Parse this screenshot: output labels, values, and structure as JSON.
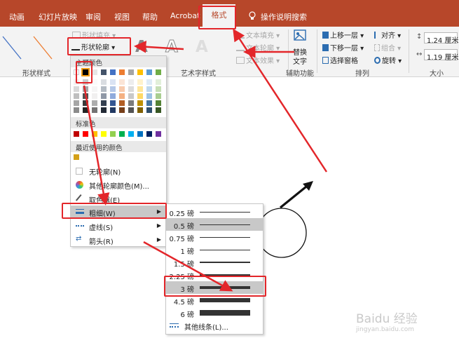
{
  "tabs": [
    "动画",
    "幻灯片放映",
    "审阅",
    "视图",
    "帮助",
    "Acrobat"
  ],
  "active_tab": "格式",
  "tell_me": "操作说明搜索",
  "ribbon": {
    "shape_fill": "形状填充",
    "shape_outline": "形状轮廓",
    "text_fill": "文本填充",
    "text_outline": "文本轮廓",
    "text_effects": "文本效果",
    "alt_text_line1": "替换",
    "alt_text_line2": "文字",
    "bring_forward": "上移一层",
    "send_backward": "下移一层",
    "selection_pane": "选择窗格",
    "align": "对齐",
    "group": "组合",
    "rotate": "旋转",
    "height": "1.24 厘米",
    "width": "1.19 厘米",
    "groups": {
      "shape_styles": "形状样式",
      "wordart": "艺术字样式",
      "accessibility": "辅助功能",
      "arrange": "排列",
      "size": "大小"
    }
  },
  "menu": {
    "theme_colors": "主题颜色",
    "standard_colors": "标准色",
    "recent_colors": "最近使用的颜色",
    "no_outline": "无轮廓(N)",
    "more_colors": "其他轮廓颜色(M)...",
    "eyedropper": "取色器(E)",
    "weight": "粗细(W)",
    "dashes": "虚线(S)",
    "arrows": "箭头(R)"
  },
  "colors": {
    "theme_top": [
      "#ffffff",
      "#000000",
      "#e7e6e6",
      "#44546a",
      "#4472c4",
      "#ed7d31",
      "#a5a5a5",
      "#ffc000",
      "#5b9bd5",
      "#70ad47"
    ],
    "standard": [
      "#c00000",
      "#ff0000",
      "#ffc000",
      "#ffff00",
      "#92d050",
      "#00b050",
      "#00b0f0",
      "#0070c0",
      "#002060",
      "#7030a0"
    ],
    "recent": [
      "#d4a017"
    ]
  },
  "weights": [
    {
      "label": "0.25 磅",
      "pt": 0.25
    },
    {
      "label": "0.5 磅",
      "pt": 0.5
    },
    {
      "label": "0.75 磅",
      "pt": 0.75
    },
    {
      "label": "1 磅",
      "pt": 1
    },
    {
      "label": "1.5 磅",
      "pt": 1.5
    },
    {
      "label": "2.25 磅",
      "pt": 2.25
    },
    {
      "label": "3 磅",
      "pt": 3
    },
    {
      "label": "4.5 磅",
      "pt": 4.5
    },
    {
      "label": "6 磅",
      "pt": 6
    }
  ],
  "more_lines": "其他线条(L)...",
  "watermark": {
    "text1": "Baidu 经验",
    "text2": "jingyan.baidu.com"
  }
}
